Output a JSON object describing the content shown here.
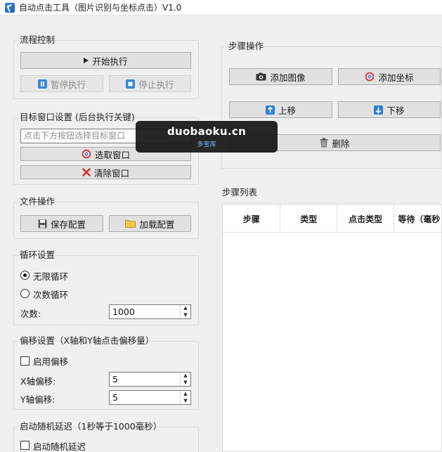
{
  "window": {
    "title": "自动点击工具（图片识别与坐标点击）V1.0"
  },
  "flow": {
    "title": "流程控制",
    "start_label": "开始执行",
    "pause_label": "暂停执行",
    "stop_label": "停止执行"
  },
  "target": {
    "title": "目标窗口设置 (后台执行关键)",
    "placeholder": "点击下方按钮选择目标窗口",
    "pick_label": "选取窗口",
    "clear_label": "清除窗口"
  },
  "file": {
    "title": "文件操作",
    "save_label": "保存配置",
    "load_label": "加载配置"
  },
  "loop": {
    "title": "循环设置",
    "infinite_label": "无限循环",
    "count_label": "次数循环",
    "times_label": "次数:",
    "times_value": "1000",
    "mode": "infinite"
  },
  "offset": {
    "title": "偏移设置（X轴和Y轴点击偏移量）",
    "enable_label": "启用偏移",
    "enabled": false,
    "x_label": "X轴偏移:",
    "x_value": "5",
    "y_label": "Y轴偏移:",
    "y_value": "5"
  },
  "delay": {
    "title": "启动随机延迟（1秒等于1000毫秒）",
    "enable_label": "启动随机延迟",
    "enabled": false
  },
  "steps_ops": {
    "title": "步骤操作",
    "add_image_label": "添加图像",
    "add_coord_label": "添加坐标",
    "up_label": "上移",
    "down_label": "下移",
    "delete_label": "删除"
  },
  "steps_list": {
    "title": "步骤列表",
    "columns": [
      "步骤",
      "类型",
      "点击类型",
      "等待（毫秒"
    ]
  },
  "watermark": {
    "main": "duobaoku.cn",
    "sub": "多宝库"
  },
  "colors": {
    "window_bg": "#f0f0f0",
    "button_bg": "#e1e1e1",
    "accent_blue": "#1f6fd1",
    "danger_red": "#d92b2b"
  }
}
